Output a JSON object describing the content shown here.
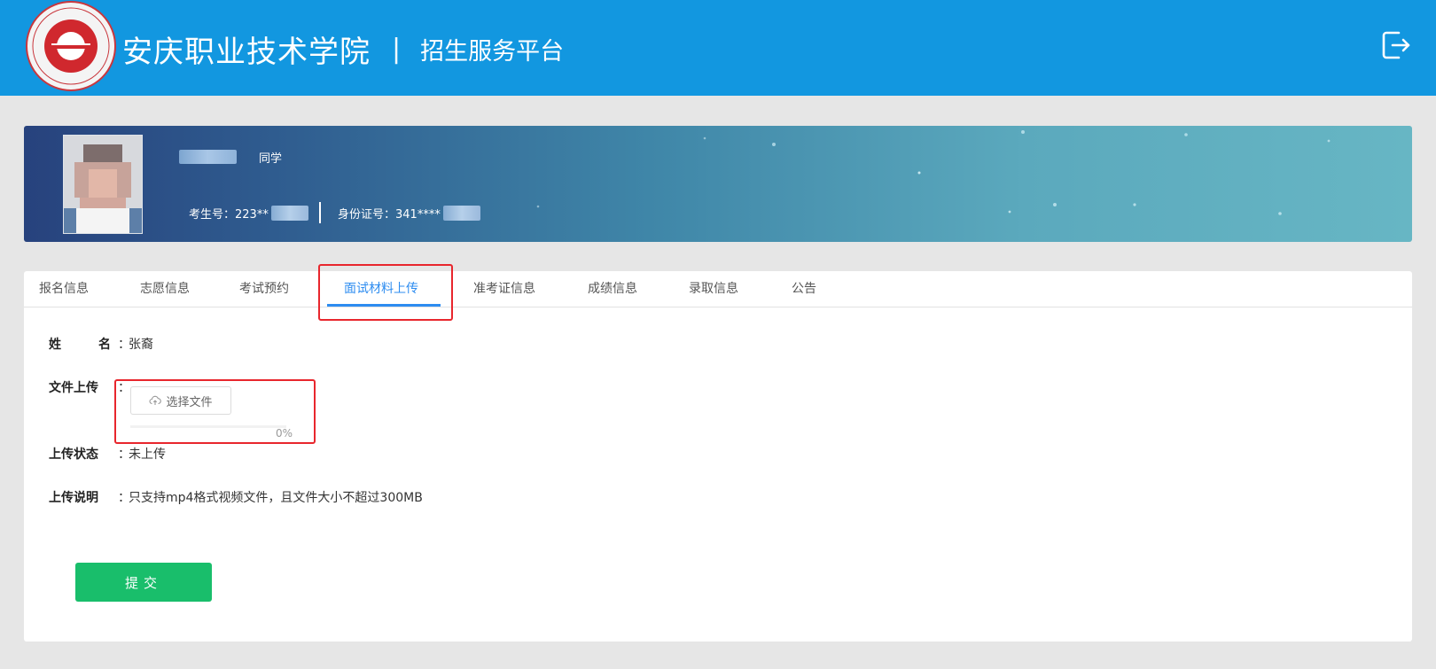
{
  "header": {
    "school_name": "安庆职业技术学院",
    "separator": "|",
    "platform_name": "招生服务平台",
    "logout_icon": "logout-icon"
  },
  "profile": {
    "greeting": "同学",
    "exam_number_label": "考生号：223**",
    "id_number_label": "身份证号：341****"
  },
  "tabs": [
    {
      "label": "报名信息"
    },
    {
      "label": "志愿信息"
    },
    {
      "label": "考试预约"
    },
    {
      "label": "面试材料上传",
      "active": true
    },
    {
      "label": "准考证信息"
    },
    {
      "label": "成绩信息"
    },
    {
      "label": "录取信息"
    },
    {
      "label": "公告"
    }
  ],
  "form": {
    "name_label_a": "姓",
    "name_label_b": "名",
    "name_value": "张裔",
    "file_label": "文件上传",
    "choose_file_label": "选择文件",
    "progress_percent": 0,
    "progress_text": "0%",
    "status_label": "上传状态",
    "status_value": "未上传",
    "note_label": "上传说明",
    "note_value": "只支持mp4格式视频文件，且文件大小不超过300MB",
    "colon": "："
  },
  "submit_label": "提交",
  "colors": {
    "header_bg": "#1297e0",
    "tab_active": "#2d8cf0",
    "submit_bg": "#19be6b",
    "highlight": "#e8262d"
  }
}
